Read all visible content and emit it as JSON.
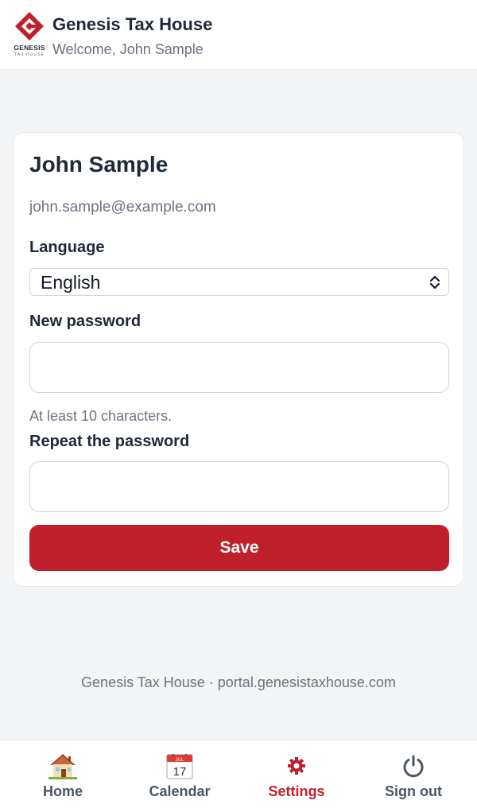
{
  "header": {
    "logo_word": "GENESIS",
    "logo_sub": "TAX HOUSE",
    "title": "Genesis Tax House",
    "welcome": "Welcome, John Sample"
  },
  "profile": {
    "name": "John Sample",
    "email": "john.sample@example.com"
  },
  "form": {
    "language_label": "Language",
    "language_value": "English",
    "new_password_label": "New password",
    "new_password_value": "",
    "password_hint": "At least 10 characters.",
    "repeat_password_label": "Repeat the password",
    "repeat_password_value": "",
    "save_label": "Save"
  },
  "footer": {
    "text": "Genesis Tax House · portal.genesistaxhouse.com"
  },
  "nav": {
    "items": [
      {
        "label": "Home",
        "icon": "house-icon",
        "active": false
      },
      {
        "label": "Calendar",
        "icon": "calendar-icon",
        "active": false
      },
      {
        "label": "Settings",
        "icon": "gear-icon",
        "active": true
      },
      {
        "label": "Sign out",
        "icon": "power-icon",
        "active": false
      }
    ],
    "calendar_month": "JUL",
    "calendar_day": "17"
  },
  "colors": {
    "brand_red": "#c0202b",
    "background": "#f3f4f6",
    "text_muted": "#6b7280"
  }
}
